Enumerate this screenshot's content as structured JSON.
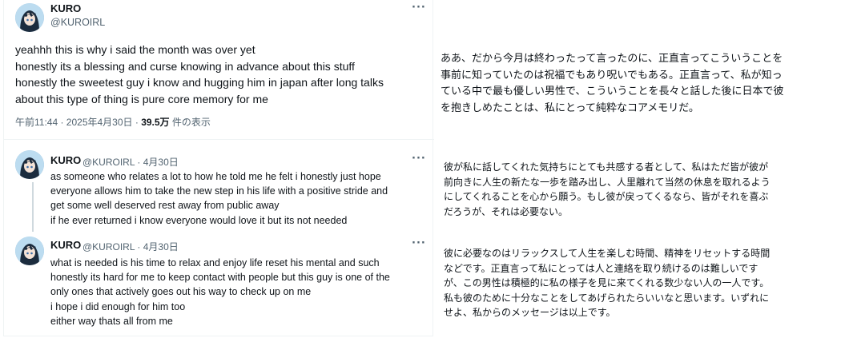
{
  "main_tweet": {
    "name": "KURO",
    "handle": "@KUROIRL",
    "more": "···",
    "lines": [
      "yeahhh this is why i said the month was over yet",
      "honestly its a blessing and curse knowing in advance about this stuff",
      "honestly the sweetest guy i know and hugging him in japan after long talks",
      "about this type of thing is pure core memory for me"
    ],
    "time": "午前11:44 · 2025年4月30日 · ",
    "views": "39.5万",
    "views_suffix": " 件の表示"
  },
  "replies": [
    {
      "name": "KURO",
      "handle_date": "@KUROIRL · 4月30日",
      "more": "···",
      "lines": [
        "as someone who relates a lot to how he told me he felt i honestly just hope",
        "everyone allows him to take the new step in his life with a positive stride and",
        "get some well deserved rest away from public away",
        "if he ever returned i know everyone would love it but its not needed"
      ]
    },
    {
      "name": "KURO",
      "handle_date": "@KUROIRL · 4月30日",
      "more": "···",
      "lines": [
        "what is needed is his time to relax and enjoy life reset his mental and such",
        "honestly its hard for me to keep contact with people but this guy is one of the",
        "only ones that actively goes out his way to check up on me",
        "i hope i did enough for him too",
        "either way thats all from me"
      ]
    }
  ],
  "translations": [
    {
      "lines": [
        "ああ、だから今月は終わったって言ったのに、正直言ってこういうことを",
        "事前に知っていたのは祝福でもあり呪いでもある。正直言って、私が知っ",
        "ている中で最も優しい男性で、こういうことを長々と話した後に日本で彼",
        "を抱きしめたことは、私にとって純粋なコアメモリだ。"
      ]
    },
    {
      "lines": [
        "彼が私に話してくれた気持ちにとても共感する者として、私はただ皆が彼が",
        "前向きに人生の新たな一歩を踏み出し、人里離れて当然の休息を取れるよう",
        "にしてくれることを心から願う。もし彼が戻ってくるなら、皆がそれを喜ぶ",
        "だろうが、それは必要ない。"
      ]
    },
    {
      "lines": [
        "彼に必要なのはリラックスして人生を楽しむ時間、精神をリセットする時間",
        "などです。正直言って私にとっては人と連絡を取り続けるのは難しいです",
        "が、この男性は積極的に私の様子を見に来てくれる数少ない人の一人です。",
        "私も彼のために十分なことをしてあげられたらいいなと思います。いずれに",
        "せよ、私からのメッセージは以上です。"
      ]
    }
  ],
  "colors": {
    "text": "#0f1419",
    "secondary": "#536471",
    "border": "#eff3f4"
  },
  "icons": [
    "avatar",
    "more-options-icon"
  ]
}
